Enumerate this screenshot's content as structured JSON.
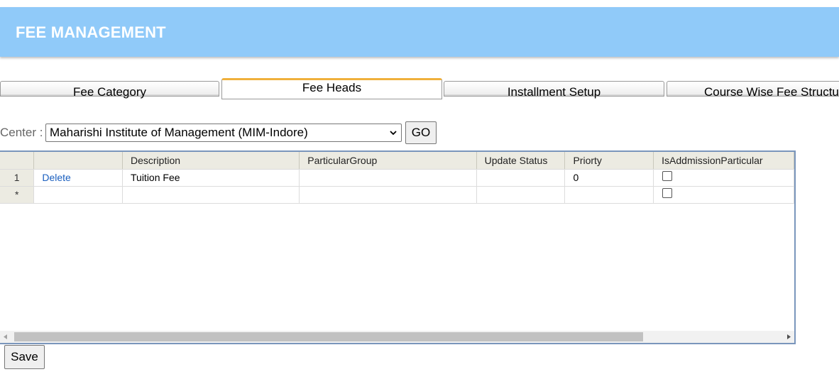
{
  "header": {
    "title": "FEE MANAGEMENT",
    "bg_color": "#90caf9"
  },
  "tabs": [
    {
      "label": "Fee Category",
      "active": false
    },
    {
      "label": "Fee Heads",
      "active": true
    },
    {
      "label": "Installment Setup",
      "active": false
    },
    {
      "label": "Course Wise Fee Structure",
      "active": false
    }
  ],
  "filter": {
    "center_label": "Center :",
    "center_value": "Maharishi Institute of Management (MIM-Indore)",
    "go_label": "GO"
  },
  "grid": {
    "columns": [
      "",
      "",
      "Description",
      "ParticularGroup",
      "Update Status",
      "Priorty",
      "IsAddmissionParticular"
    ],
    "rows": [
      {
        "row_header": "1",
        "action": "Delete",
        "description": "Tuition Fee",
        "particular_group": "",
        "update_status": "",
        "priorty": "0",
        "is_admission_particular": false
      },
      {
        "row_header": "*",
        "action": "",
        "description": "",
        "particular_group": "",
        "update_status": "",
        "priorty": "",
        "is_admission_particular": false
      }
    ]
  },
  "save_label": "Save",
  "icons": {
    "select": "chevron-down-icon",
    "scroll_left": "scroll-left-arrow-icon",
    "scroll_right": "scroll-right-arrow-icon"
  }
}
